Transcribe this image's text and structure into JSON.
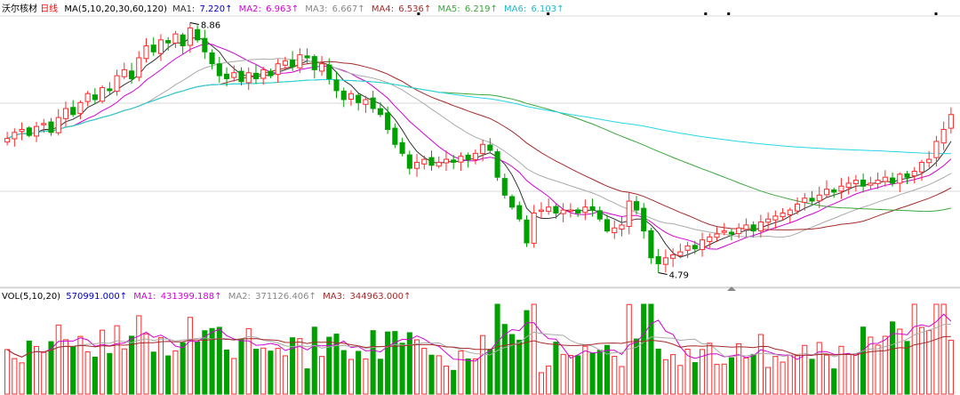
{
  "stock": {
    "name": "沃尔核材",
    "period": "日线"
  },
  "colors": {
    "up": "#ff2a2a",
    "down": "#00a000",
    "ma1": "#333333",
    "ma2": "#d400d4",
    "ma3": "#aaaaaa",
    "ma4": "#a52a2a",
    "ma5": "#3aa63a",
    "ma6": "#29d6e6",
    "grid": "#d8d8d8",
    "label_blue": "#0000c8"
  },
  "price_legend": {
    "indicator": "MA(5,10,20,30,60,120)",
    "items": [
      {
        "label": "MA1:",
        "value": "7.220↑",
        "color": "#333333"
      },
      {
        "label": "MA2:",
        "value": "6.963↑",
        "color": "#d400d4"
      },
      {
        "label": "MA3:",
        "value": "6.667↑",
        "color": "#888888"
      },
      {
        "label": "MA4:",
        "value": "6.536↑",
        "color": "#a52a2a"
      },
      {
        "label": "MA5:",
        "value": "6.219↑",
        "color": "#3aa63a"
      },
      {
        "label": "MA6:",
        "value": "6.103↑",
        "color": "#29b6c6"
      }
    ]
  },
  "volume_legend": {
    "indicator": "VOL(5,10,20)",
    "vol_value": "570991.000↑",
    "items": [
      {
        "label": "MA1:",
        "value": "431399.188↑",
        "color": "#d400d4"
      },
      {
        "label": "MA2:",
        "value": "371126.406↑",
        "color": "#888888"
      },
      {
        "label": "MA3:",
        "value": "344963.000↑",
        "color": "#a52a2a"
      }
    ]
  },
  "chart_data": {
    "type": "candlestick",
    "period": "daily",
    "y_range": [
      4.5,
      9.0
    ],
    "high_marker": "8.86",
    "low_marker": "4.79",
    "approx_closes": [
      6.95,
      7.05,
      7.1,
      7.0,
      7.15,
      7.2,
      7.05,
      7.3,
      7.45,
      7.35,
      7.55,
      7.7,
      7.6,
      7.8,
      7.75,
      8.0,
      8.1,
      7.95,
      8.3,
      8.5,
      8.4,
      8.6,
      8.55,
      8.7,
      8.5,
      8.8,
      8.6,
      8.4,
      8.2,
      8.0,
      7.95,
      8.05,
      7.9,
      8.05,
      7.95,
      8.1,
      8.0,
      8.2,
      8.25,
      8.15,
      8.35,
      8.3,
      8.1,
      8.2,
      7.95,
      7.75,
      7.6,
      7.7,
      7.55,
      7.6,
      7.45,
      7.35,
      7.1,
      6.85,
      6.7,
      6.45,
      6.55,
      6.6,
      6.5,
      6.55,
      6.6,
      6.55,
      6.65,
      6.6,
      6.7,
      6.85,
      6.75,
      6.3,
      6.0,
      5.8,
      5.6,
      5.2,
      5.7,
      5.75,
      5.8,
      5.7,
      5.75,
      5.75,
      5.7,
      5.8,
      5.75,
      5.6,
      5.4,
      5.45,
      5.5,
      5.9,
      5.75,
      5.4,
      4.95,
      4.85,
      4.95,
      5.0,
      5.05,
      5.15,
      5.1,
      5.25,
      5.3,
      5.35,
      5.4,
      5.35,
      5.45,
      5.5,
      5.4,
      5.55,
      5.6,
      5.65,
      5.7,
      5.75,
      5.85,
      5.95,
      5.9,
      6.0,
      6.1,
      6.05,
      6.15,
      6.2,
      6.25,
      6.15,
      6.2,
      6.25,
      6.3,
      6.2,
      6.35,
      6.3,
      6.4,
      6.55,
      6.6,
      6.9,
      7.1,
      7.35
    ],
    "price_ma_series": [
      {
        "name": "MA1"
      },
      {
        "name": "MA2"
      },
      {
        "name": "MA3"
      },
      {
        "name": "MA4"
      },
      {
        "name": "MA5"
      },
      {
        "name": "MA6"
      }
    ],
    "volume_ma_series": [
      {
        "name": "MA1"
      },
      {
        "name": "MA2"
      },
      {
        "name": "MA3"
      }
    ]
  }
}
